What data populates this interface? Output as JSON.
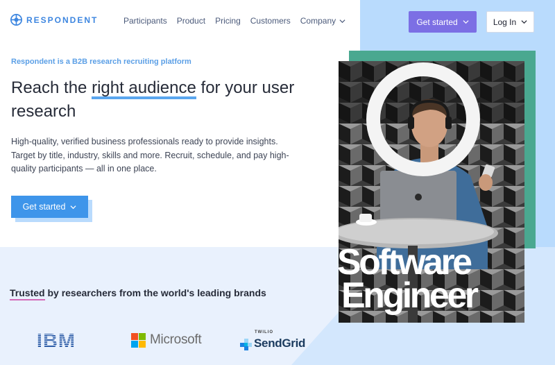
{
  "brand": {
    "name": "RESPONDENT",
    "accent": "#3d86e0",
    "purple": "#7c6fe4",
    "blue": "#3e95ea"
  },
  "nav": {
    "items": [
      {
        "label": "Participants"
      },
      {
        "label": "Product"
      },
      {
        "label": "Pricing"
      },
      {
        "label": "Customers"
      },
      {
        "label": "Company",
        "icon": "chevron-down-icon"
      }
    ],
    "get_started": "Get started",
    "login": "Log In"
  },
  "hero": {
    "eyebrow": "Respondent is a B2B research recruiting platform",
    "headline_pre": "Reach the ",
    "headline_highlight": "right audience",
    "headline_post": " for your user research",
    "description": "High-quality, verified business professionals ready to provide insights. Target by title, industry, skills and more. Recruit, schedule, and pay high-quality participants — all in one place.",
    "cta": "Get started",
    "overlay_line1": "Software",
    "overlay_line2": "Engineer"
  },
  "trusted": {
    "mark": "Trusted",
    "rest": " by researchers from the world's leading brands"
  },
  "brands": {
    "ibm": "IBM",
    "microsoft": "Microsoft",
    "sendgrid_top": "TWILIO",
    "sendgrid": "SendGrid"
  }
}
